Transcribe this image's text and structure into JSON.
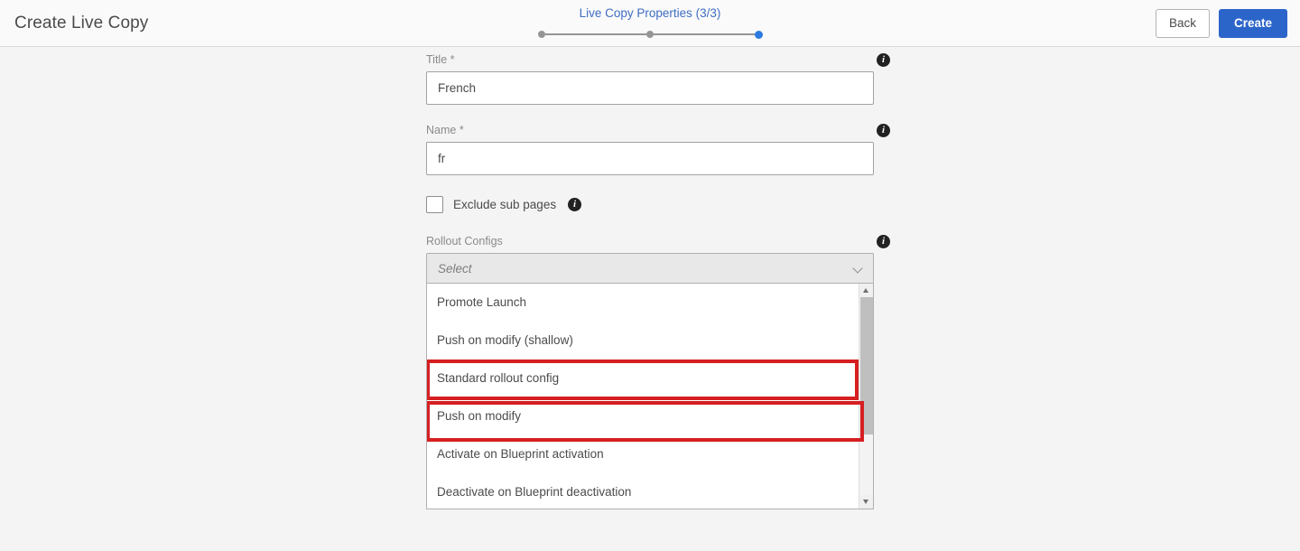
{
  "header": {
    "title": "Create Live Copy",
    "wizard": {
      "label": "Live Copy Properties (3/3)",
      "steps": [
        {
          "state": "inactive"
        },
        {
          "state": "inactive"
        },
        {
          "state": "active"
        }
      ]
    },
    "back_label": "Back",
    "create_label": "Create",
    "accent_color": "#2c65c9",
    "step_label_color": "#3f6ec2"
  },
  "form": {
    "title_field": {
      "label": "Title *",
      "value": "French",
      "placeholder": "",
      "info": "i"
    },
    "name_field": {
      "label": "Name *",
      "value": "fr",
      "placeholder": "",
      "info": "i"
    },
    "exclude_sub_pages": {
      "label": "Exclude sub pages",
      "checked": false,
      "info": "i"
    },
    "rollout_configs": {
      "label": "Rollout Configs",
      "info": "i",
      "select_placeholder": "Select",
      "chevron": "chevron-down",
      "options": [
        "Promote Launch",
        "Push on modify (shallow)",
        "Standard rollout config",
        "Push on modify",
        "Activate on Blueprint activation",
        "Deactivate on Blueprint deactivation"
      ]
    }
  },
  "annotations": {
    "highlight_color": "#d61f21",
    "boxes": [
      {
        "target": "Standard rollout config"
      },
      {
        "target": "Push on modify"
      }
    ]
  }
}
